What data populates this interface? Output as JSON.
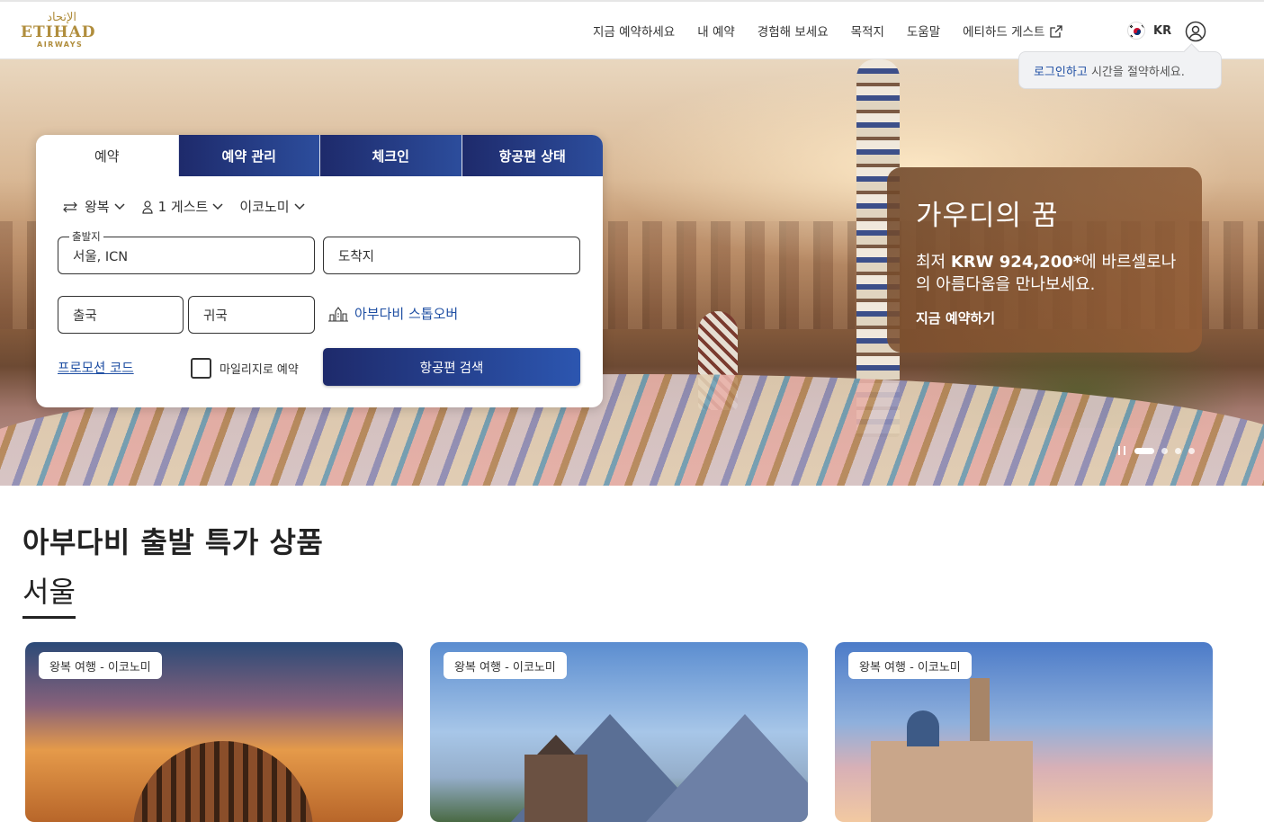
{
  "brand": {
    "arabic": "الإتحاد",
    "name": "ETIHAD",
    "sub": "AIRWAYS",
    "gold": "#b08d3c"
  },
  "nav": {
    "items": [
      "지금 예약하세요",
      "내 예약",
      "경험해 보세요",
      "목적지",
      "도움말",
      "에티하드 게스트"
    ],
    "lang_code": "KR"
  },
  "tooltip": {
    "link": "로그인하고",
    "text": " 시간을 절약하세요."
  },
  "hero": {
    "promo": {
      "title": "가우디의 꿈",
      "line1": "최저 ",
      "price": "KRW 924,200*",
      "line2": "에 바르셀로나의 아름다움을 만나보세요.",
      "cta": "지금 예약하기"
    },
    "carousel": {
      "slides": 4,
      "active": 1
    }
  },
  "booking": {
    "tabs": [
      "예약",
      "예약 관리",
      "체크인",
      "항공편 상태"
    ],
    "active_tab": 0,
    "trip_type": "왕복",
    "guests": "1 게스트",
    "cabin": "이코노미",
    "origin": {
      "label": "출발지",
      "value": "서울, ICN"
    },
    "destination": {
      "placeholder": "도착지"
    },
    "depart": {
      "placeholder": "출국"
    },
    "return": {
      "placeholder": "귀국"
    },
    "stopover": "아부다비 스톱오버",
    "promo_code": "프로모션 코드",
    "miles": "마일리지로 예약",
    "search": "항공편 검색",
    "accent": "#1e2a6b"
  },
  "deals": {
    "title": "아부다비 출발 특가 상품",
    "city": "서울",
    "cards": [
      {
        "tag": "왕복 여행 - 이코노미"
      },
      {
        "tag": "왕복 여행 - 이코노미"
      },
      {
        "tag": "왕복 여행 - 이코노미"
      }
    ]
  }
}
